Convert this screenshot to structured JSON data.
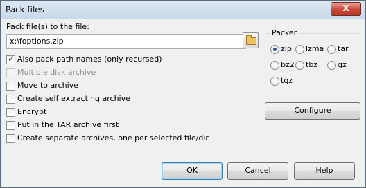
{
  "window": {
    "title": "Pack files",
    "close_label": "X"
  },
  "pack_to": {
    "label": "Pack file(s) to the file:",
    "value": "x:\\foptions.zip"
  },
  "options": [
    {
      "label": "Also pack path names (only recursed)",
      "checked": true,
      "disabled": false
    },
    {
      "label": "Multiple disk archive",
      "checked": false,
      "disabled": true
    },
    {
      "label": "Move to archive",
      "checked": false,
      "disabled": false
    },
    {
      "label": "Create self extracting archive",
      "checked": false,
      "disabled": false
    },
    {
      "label": "Encrypt",
      "checked": false,
      "disabled": false
    },
    {
      "label": "Put in the TAR archive first",
      "checked": false,
      "disabled": false
    },
    {
      "label": "Create separate archives, one per selected file/dir",
      "checked": false,
      "disabled": false
    }
  ],
  "packer": {
    "title": "Packer",
    "selected": "zip",
    "options": [
      "zip",
      "lzma",
      "tar",
      "bz2",
      "tbz",
      "gz",
      "tgz"
    ]
  },
  "buttons": {
    "configure": "Configure",
    "ok": "OK",
    "cancel": "Cancel",
    "help": "Help"
  }
}
